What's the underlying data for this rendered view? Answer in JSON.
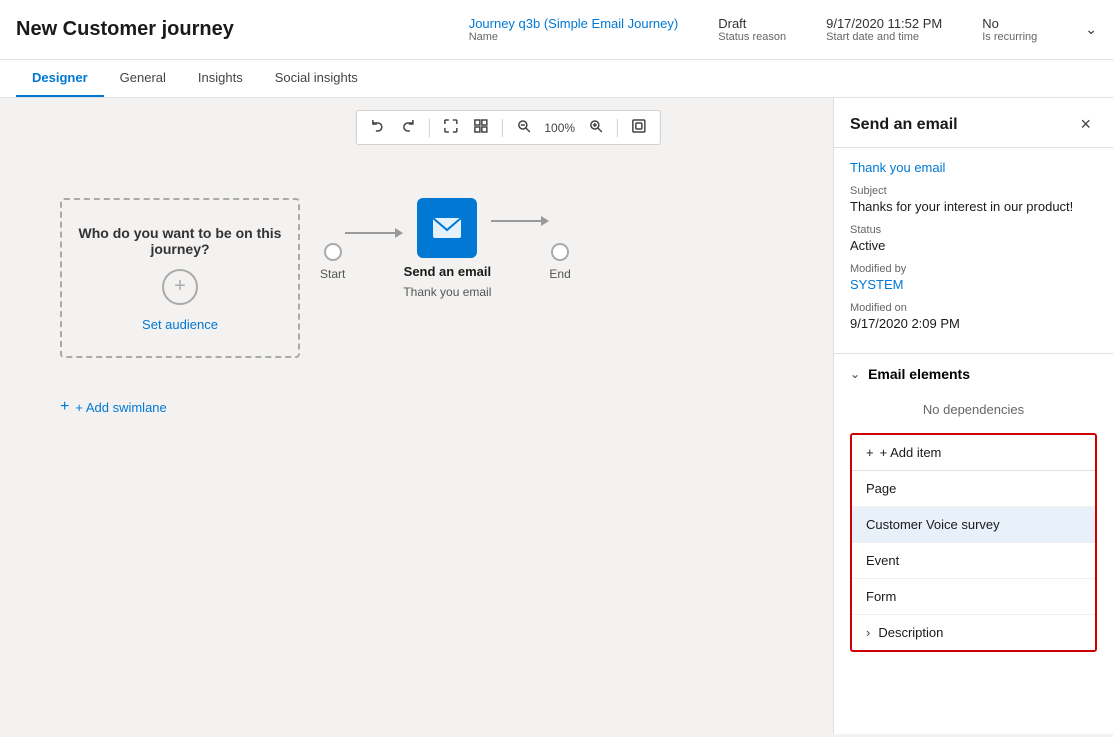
{
  "header": {
    "title": "New Customer journey",
    "meta": {
      "name_value": "Journey q3b (Simple Email Journey)",
      "name_label": "Name",
      "status_value": "Draft",
      "status_label": "Status reason",
      "date_value": "9/17/2020 11:52 PM",
      "date_label": "Start date and time",
      "recurring_value": "No",
      "recurring_label": "Is recurring"
    }
  },
  "tabs": [
    {
      "id": "designer",
      "label": "Designer",
      "active": true
    },
    {
      "id": "general",
      "label": "General",
      "active": false
    },
    {
      "id": "insights",
      "label": "Insights",
      "active": false
    },
    {
      "id": "social-insights",
      "label": "Social insights",
      "active": false
    }
  ],
  "toolbar": {
    "undo": "↩",
    "redo": "↪",
    "zoom_out_icon": "−",
    "zoom_level": "100%",
    "zoom_in_icon": "+",
    "fit_icon": "⊡"
  },
  "canvas": {
    "swimlane": {
      "text": "Who do you want to be on this journey?",
      "link": "Set audience"
    },
    "add_swimlane": "+ Add swimlane",
    "nodes": [
      {
        "id": "start",
        "label": "Start",
        "type": "circle"
      },
      {
        "id": "email",
        "label": "Send an email",
        "sublabel": "Thank you email",
        "type": "email"
      },
      {
        "id": "end",
        "label": "End",
        "type": "circle"
      }
    ]
  },
  "right_panel": {
    "title": "Send an email",
    "close_icon": "×",
    "link": "Thank you email",
    "fields": [
      {
        "label": "Subject",
        "value": "Thanks for your interest in our product!"
      },
      {
        "label": "Status",
        "value": "Active"
      },
      {
        "label": "Modified by",
        "value": "SYSTEM",
        "is_link": true
      },
      {
        "label": "Modified on",
        "value": "9/17/2020 2:09 PM"
      }
    ],
    "email_elements_section": {
      "title": "Email elements",
      "no_dependencies": "No dependencies",
      "add_item_label": "+ Add item",
      "items": [
        {
          "label": "Page"
        },
        {
          "label": "Customer Voice survey",
          "highlighted": true
        },
        {
          "label": "Event"
        },
        {
          "label": "Form"
        }
      ],
      "description_row": "Description"
    }
  }
}
